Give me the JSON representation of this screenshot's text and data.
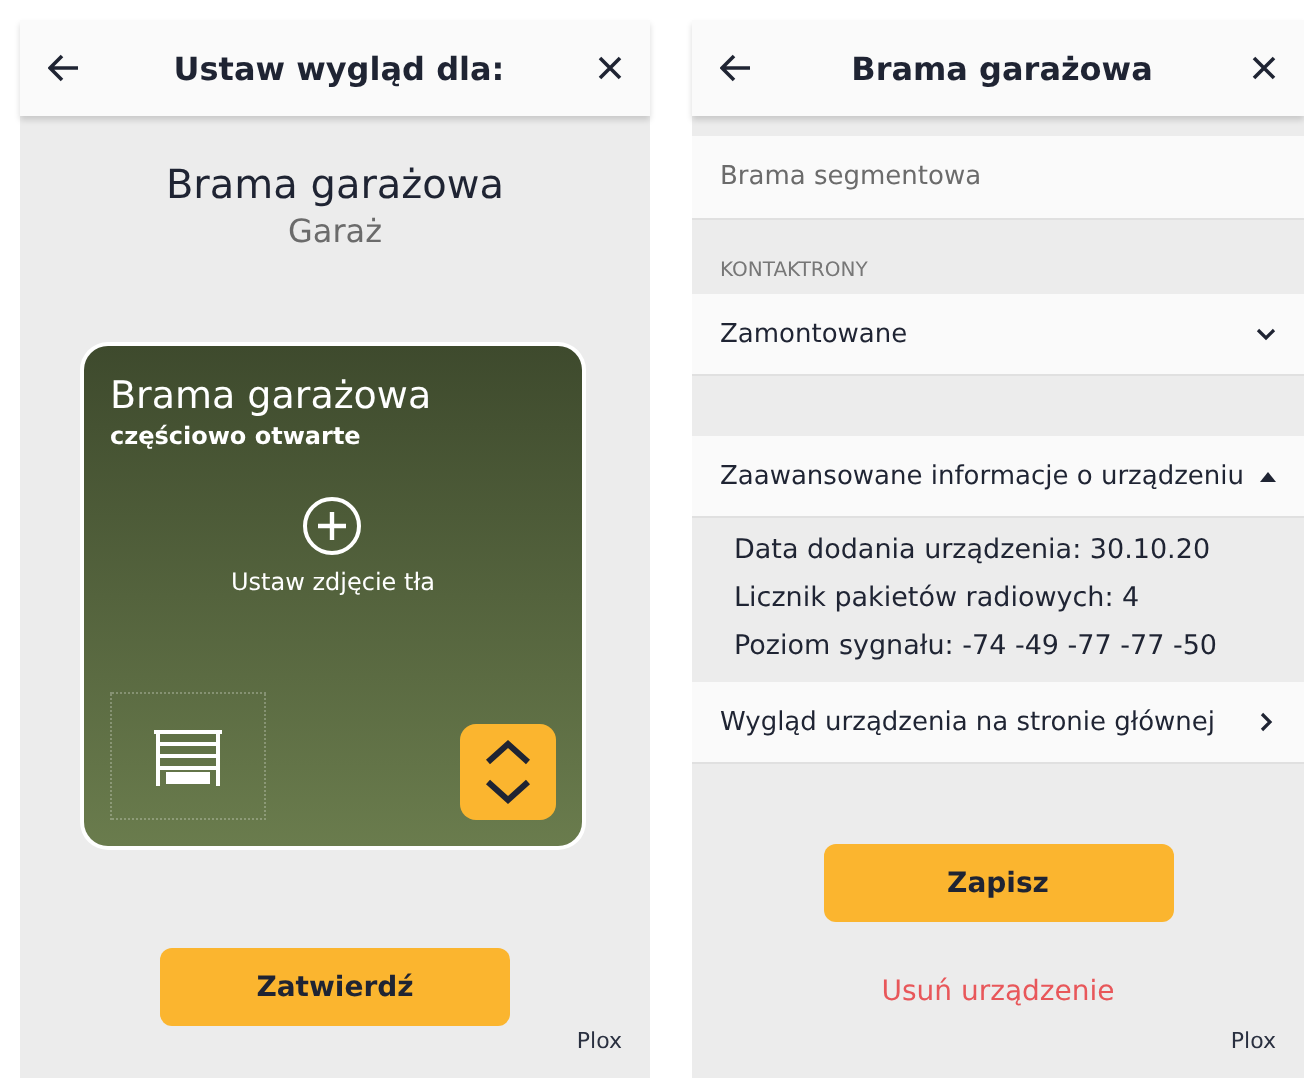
{
  "appearance_screen": {
    "header": {
      "title": "Ustaw wygląd dla:"
    },
    "device_name": "Brama garażowa",
    "room": "Garaż",
    "card": {
      "name": "Brama garażowa",
      "status": "częściowo otwarte",
      "photo_label": "Ustaw zdjęcie tła"
    },
    "confirm_button": "Zatwierdź",
    "brand": "Plox"
  },
  "device_screen": {
    "header": {
      "title": "Brama garażowa"
    },
    "rows": [
      {
        "kind": "value",
        "value": "Brama segmentowa"
      },
      {
        "kind": "select",
        "label": "KONTAKTRONY",
        "value": "Zamontowane"
      },
      {
        "kind": "expander",
        "label": "Zaawansowane informacje o urządzeniu",
        "expanded": true,
        "lines": [
          "Data dodania urządzenia: 30.10.20",
          "Licznik pakietów radiowych: 4",
          "Poziom sygnału: -74 -49 -77 -77 -50"
        ]
      },
      {
        "kind": "link",
        "label": "Wygląd urządzenia na stronie głównej"
      }
    ],
    "save_button": "Zapisz",
    "delete_link": "Usuń urządzenie",
    "brand": "Plox"
  }
}
